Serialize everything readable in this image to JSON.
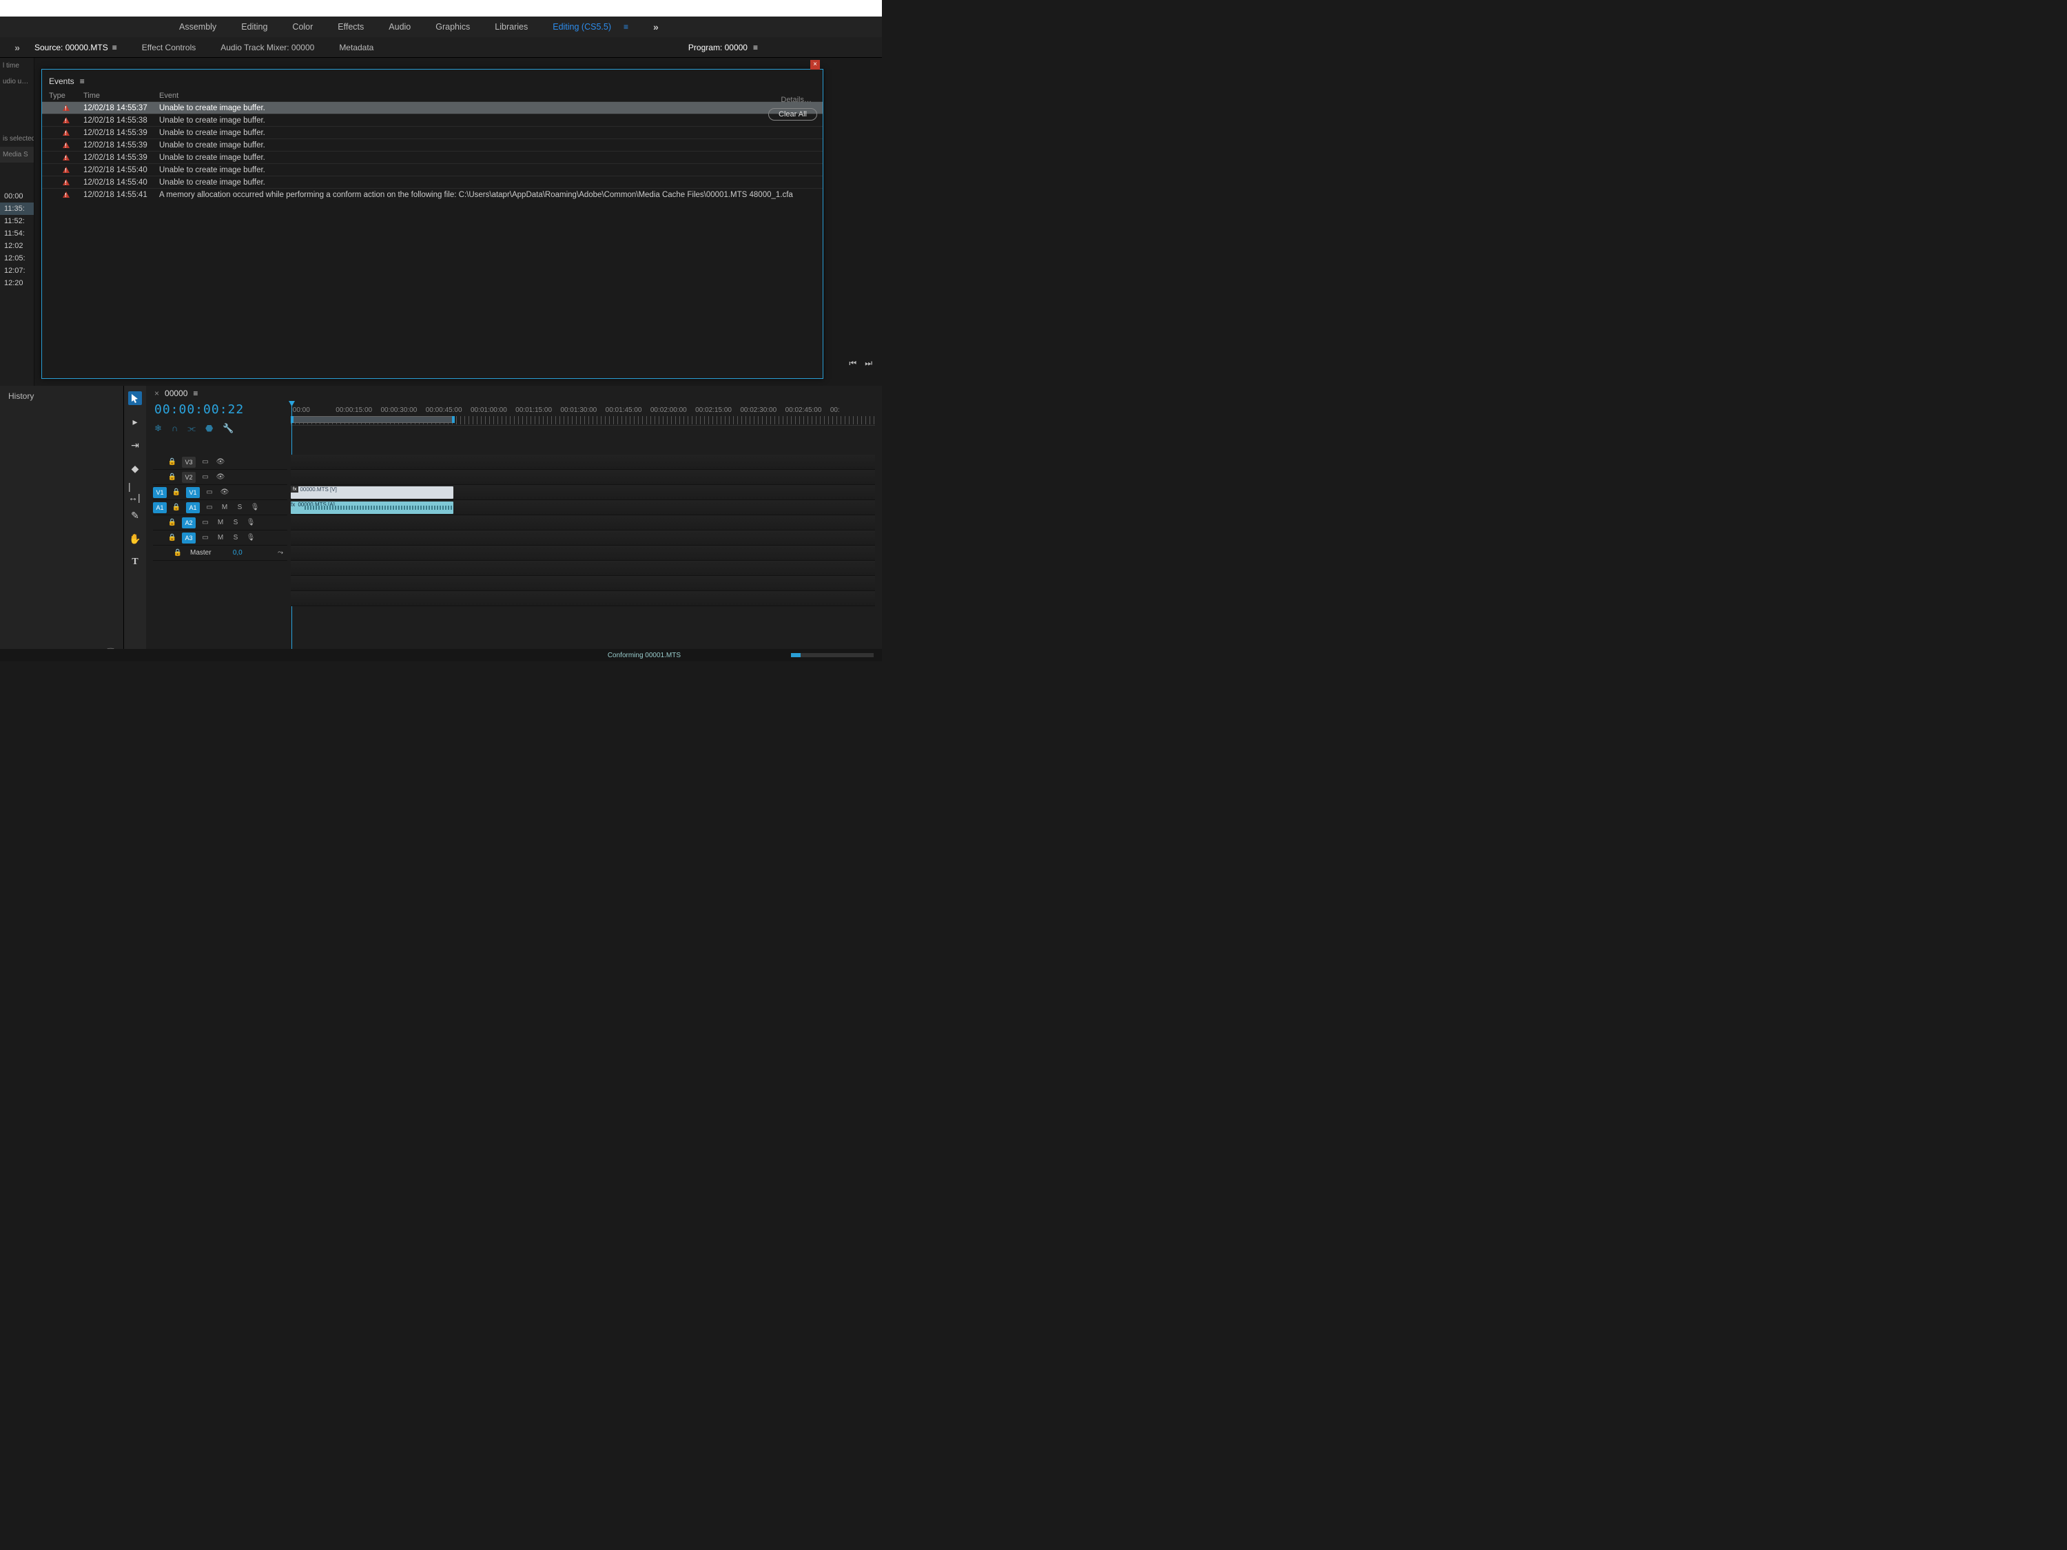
{
  "workspaces": {
    "items": [
      "Assembly",
      "Editing",
      "Color",
      "Effects",
      "Audio",
      "Graphics",
      "Libraries"
    ],
    "active": "Editing (CS5.5)"
  },
  "source_panel": {
    "expand_label": "»",
    "tabs": {
      "source": "Source: 00000.MTS",
      "effect_controls": "Effect Controls",
      "audio_mixer": "Audio Track Mixer: 00000",
      "metadata": "Metadata"
    }
  },
  "program_panel": {
    "title": "Program: 00000"
  },
  "left_rail": {
    "label_time": "l time",
    "label_audio": "udio u…",
    "label_selected": "is selected",
    "label_media": "Media S",
    "times": [
      "00:00",
      "11:35:",
      "11:52:",
      "11:54:",
      "12:02",
      "12:05:",
      "12:07:",
      "12:20"
    ]
  },
  "events": {
    "title": "Events",
    "headers": {
      "type": "Type",
      "time": "Time",
      "event": "Event"
    },
    "details_label": "Details…",
    "clear_all_label": "Clear All",
    "rows": [
      {
        "time": "12/02/18 14:55:37",
        "msg": "Unable to create image buffer.",
        "selected": true
      },
      {
        "time": "12/02/18 14:55:38",
        "msg": "Unable to create image buffer."
      },
      {
        "time": "12/02/18 14:55:39",
        "msg": "Unable to create image buffer."
      },
      {
        "time": "12/02/18 14:55:39",
        "msg": "Unable to create image buffer."
      },
      {
        "time": "12/02/18 14:55:39",
        "msg": "Unable to create image buffer."
      },
      {
        "time": "12/02/18 14:55:40",
        "msg": "Unable to create image buffer."
      },
      {
        "time": "12/02/18 14:55:40",
        "msg": "Unable to create image buffer."
      },
      {
        "time": "12/02/18 14:55:41",
        "msg": "A memory allocation occurred while performing a conform action on the following file: C:\\Users\\atapr\\AppData\\Roaming\\Adobe\\Common\\Media Cache Files\\00001.MTS 48000_1.cfa"
      }
    ]
  },
  "history_panel": {
    "title": "History"
  },
  "timeline": {
    "sequence_name": "00000",
    "playhead_time": "00:00:00:22",
    "ruler_labels": [
      ":00:00",
      "00:00:15:00",
      "00:00:30:00",
      "00:00:45:00",
      "00:01:00:00",
      "00:01:15:00",
      "00:01:30:00",
      "00:01:45:00",
      "00:02:00:00",
      "00:02:15:00",
      "00:02:30:00",
      "00:02:45:00",
      "00:"
    ],
    "tracks": {
      "v3": "V3",
      "v2": "V2",
      "v1": "V1",
      "a1": "A1",
      "a2": "A2",
      "a3": "A3",
      "src_v1": "V1",
      "src_a1": "A1",
      "master": "Master",
      "master_val": "0,0",
      "mute": "M",
      "solo": "S"
    },
    "clips": {
      "video_name": "00000.MTS [V]",
      "audio_name": "00000.MTS [A]",
      "fx": "fx"
    }
  },
  "status": {
    "conforming": "Conforming 00001.MTS"
  },
  "glyphs": {
    "menu": "≡",
    "more": "»",
    "close": "×",
    "arrow": "▸",
    "snowflake": "❄",
    "magnet": "∩",
    "wrench": "🔧",
    "marker": "⬣",
    "link": "⫘",
    "lock": "🔒",
    "cam": "▭",
    "eye": "👁",
    "mic": "🎙",
    "folder": "📁",
    "trash": "🗑",
    "newitem": "▭",
    "skip_start": "⏮",
    "skip_end": "⏭",
    "out": "⤳"
  }
}
